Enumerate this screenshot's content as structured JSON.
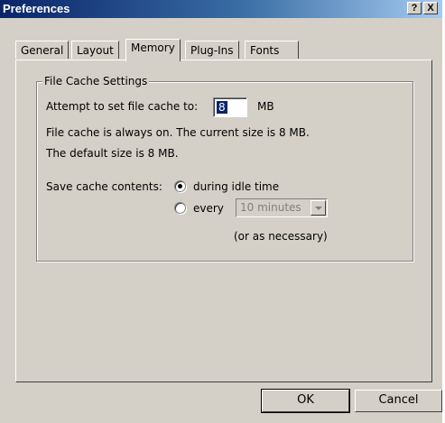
{
  "window": {
    "title": "Preferences",
    "help_glyph": "?",
    "close_glyph": "X"
  },
  "tabs": [
    {
      "label": "General"
    },
    {
      "label": "Layout"
    },
    {
      "label": "Memory"
    },
    {
      "label": "Plug-Ins"
    },
    {
      "label": "Fonts"
    }
  ],
  "memory": {
    "group_title": "File Cache Settings",
    "attempt_label": "Attempt to set file cache to:",
    "cache_value": "8",
    "cache_unit": "MB",
    "info_line1": "File cache is always on.  The current size is 8 MB.",
    "info_line2": "The default size is 8 MB.",
    "save_label": "Save cache contents:",
    "option_idle": "during idle time",
    "option_every": "every",
    "interval_value": "10 minutes",
    "note": "(or as necessary)"
  },
  "buttons": {
    "ok": "OK",
    "cancel": "Cancel"
  },
  "colors": {
    "titlebar_start": "#0a246a",
    "titlebar_end": "#a6caf0",
    "face": "#d4d0c8"
  }
}
